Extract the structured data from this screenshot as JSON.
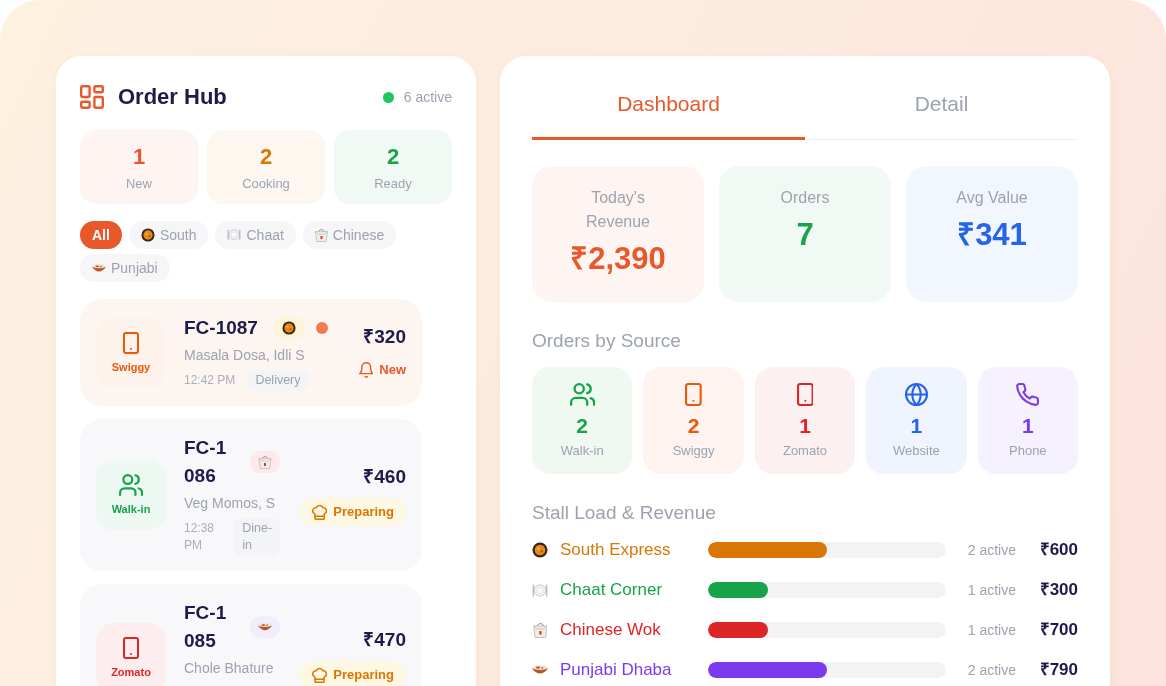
{
  "order_hub": {
    "title": "Order Hub",
    "active_count": "6 active",
    "stats": [
      {
        "value": "1",
        "label": "New",
        "color": "#e8582a"
      },
      {
        "value": "2",
        "label": "Cooking",
        "color": "#d97706"
      },
      {
        "value": "2",
        "label": "Ready",
        "color": "#16a34a"
      }
    ],
    "filters": [
      {
        "kind": "all",
        "label": "All",
        "selected": true
      },
      {
        "kind": "south",
        "label": "South",
        "selected": false
      },
      {
        "kind": "chaat",
        "label": "Chaat",
        "selected": false
      },
      {
        "kind": "chinese",
        "label": "Chinese",
        "selected": false
      },
      {
        "kind": "punjabi",
        "label": "Punjabi",
        "selected": false
      }
    ],
    "orders": [
      {
        "id": "FC-1087",
        "source": {
          "kind": "swiggy",
          "label": "Swiggy"
        },
        "cuisine": {
          "kind": "south"
        },
        "items": "Masala Dosa, Idli S",
        "time": "12:42 PM",
        "service": "Delivery",
        "total": "₹320",
        "status": {
          "kind": "new",
          "label": "New"
        }
      },
      {
        "id": "FC-1086",
        "source": {
          "kind": "walkin",
          "label": "Walk-in"
        },
        "cuisine": {
          "kind": "chinese"
        },
        "items": "Veg Momos, S",
        "time": "12:38 PM",
        "service": "Dine-in",
        "total": "₹460",
        "status": {
          "kind": "preparing",
          "label": "Preparing"
        }
      },
      {
        "id": "FC-1085",
        "source": {
          "kind": "zomato",
          "label": "Zomato"
        },
        "cuisine": {
          "kind": "punjabi"
        },
        "items": "Chole Bhature",
        "total": "₹470",
        "status": {
          "kind": "preparing",
          "label": "Preparing"
        }
      }
    ]
  },
  "dashboard": {
    "tabs": [
      {
        "label": "Dashboard",
        "selected": true
      },
      {
        "label": "Detail",
        "selected": false
      }
    ],
    "metrics": [
      {
        "label": "Today's Revenue",
        "value": "₹2,390",
        "color": "#e8582a"
      },
      {
        "label": "Orders",
        "value": "7",
        "color": "#16a34a"
      },
      {
        "label": "Avg Value",
        "value": "₹341",
        "color": "#2563eb"
      }
    ],
    "sources": {
      "title": "Orders by Source",
      "items": [
        {
          "kind": "walkin",
          "value": "2",
          "label": "Walk-in"
        },
        {
          "kind": "swiggy",
          "value": "2",
          "label": "Swiggy"
        },
        {
          "kind": "zomato",
          "value": "1",
          "label": "Zomato"
        },
        {
          "kind": "website",
          "value": "1",
          "label": "Website"
        },
        {
          "kind": "phone",
          "value": "1",
          "label": "Phone"
        }
      ]
    },
    "stalls": {
      "title": "Stall Load & Revenue",
      "items": [
        {
          "kind": "south",
          "name": "South Express",
          "color": "#d97706",
          "level": 0.5,
          "active": "2 active",
          "revenue": "₹600"
        },
        {
          "kind": "chaat",
          "name": "Chaat Corner",
          "color": "#16a34a",
          "level": 0.25,
          "active": "1 active",
          "revenue": "₹300"
        },
        {
          "kind": "chinese",
          "name": "Chinese Wok",
          "color": "#dc2626",
          "level": 0.25,
          "active": "1 active",
          "revenue": "₹700"
        },
        {
          "kind": "punjabi",
          "name": "Punjabi Dhaba",
          "color": "#7c3aed",
          "level": 0.5,
          "active": "2 active",
          "revenue": "₹790"
        }
      ]
    }
  }
}
